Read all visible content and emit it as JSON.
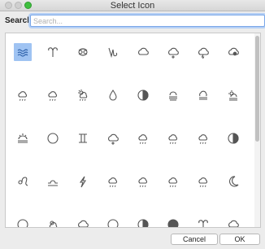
{
  "window": {
    "title": "Select Icon"
  },
  "search": {
    "label": "Search:",
    "placeholder": "Search..."
  },
  "icons": [
    [
      "waves-icon",
      "aries-icon",
      "cancer-icon",
      "capricorn-icon",
      "cloud-icon",
      "cloud-drizzle-icon",
      "cloud-lightning-icon",
      "cloud-hail-icon"
    ],
    [
      "cloud-rain-sun-icon",
      "cloud-rain-sun-icon",
      "sun-cloud-rain-icon",
      "raindrop-icon",
      "half-moon-icon",
      "fog-sun-icon",
      "fog-cloud-icon",
      "sun-fog-icon"
    ],
    [
      "sunrise-icon",
      "circle-icon",
      "gemini-icon",
      "cloud-drizzle-icon",
      "cloud-rain-icon",
      "cloud-rain-icon",
      "cloud-rain-icon",
      "half-circle-icon"
    ],
    [
      "leo-icon",
      "libra-icon",
      "lightning-icon",
      "cloud-rain-icon",
      "cloud-rain-icon",
      "cloud-rain-icon",
      "cloud-rain-icon",
      "crescent-moon-icon"
    ],
    [
      "circle-icon",
      "sun-cloud-icon",
      "cloud-icon",
      "circle-icon",
      "half-circle-icon",
      "full-moon-icon",
      "aries-icon",
      "cloud-icon"
    ]
  ],
  "buttons": {
    "cancel": "Cancel",
    "ok": "OK"
  }
}
